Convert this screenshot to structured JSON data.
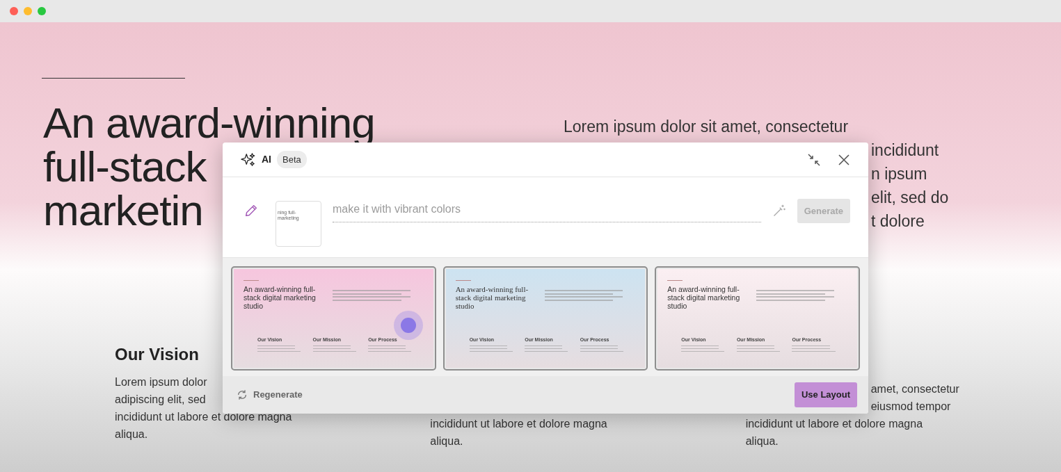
{
  "page": {
    "heading_lines": [
      "An award-winning",
      "full-stack",
      "marketin"
    ],
    "intro": {
      "first_line": "Lorem ipsum dolor sit amet, consectetur",
      "partial_lines": [
        "incididunt",
        "n ipsum",
        "elit, sed do",
        "t dolore"
      ]
    },
    "columns": [
      {
        "title": "Our Vision",
        "lines": [
          "Lorem ipsum dolor",
          "adipiscing elit, sed",
          "incididunt ut labore et dolore magna",
          "aliqua."
        ]
      },
      {
        "lines": [
          "incididunt ut labore et dolore magna",
          "aliqua."
        ]
      },
      {
        "partial_lines": [
          "amet, consectetur",
          "eiusmod tempor"
        ],
        "lines": [
          "incididunt ut labore et dolore magna",
          "aliqua."
        ]
      }
    ]
  },
  "ai_panel": {
    "title": "AI",
    "badge": "Beta",
    "prompt": {
      "placeholder": "make it with vibrant colors",
      "thumbnail_lines": [
        "ning full-",
        "marketing"
      ]
    },
    "generate_button": {
      "label": "Generate",
      "disabled": true
    },
    "layouts": [
      {
        "kind": "sans",
        "color": "#f6c6de",
        "hovered": true,
        "heading": "An award-winning full-stack digital marketing studio",
        "columns": [
          "Our Vision",
          "Our Mission",
          "Our Process"
        ]
      },
      {
        "kind": "serif",
        "color": "#cde3f1",
        "hovered": false,
        "heading": "An award-winning full-stack digital marketing studio",
        "columns": [
          "Our Vision",
          "Our Mission",
          "Our Process"
        ]
      },
      {
        "kind": "sans",
        "color": "#fbeff2",
        "hovered": false,
        "heading": "An award-winning full-stack digital marketing studio",
        "columns": [
          "Our Vision",
          "Our Mission",
          "Our Process"
        ]
      }
    ],
    "regenerate": "Regenerate",
    "use_button": "Use Layout"
  }
}
